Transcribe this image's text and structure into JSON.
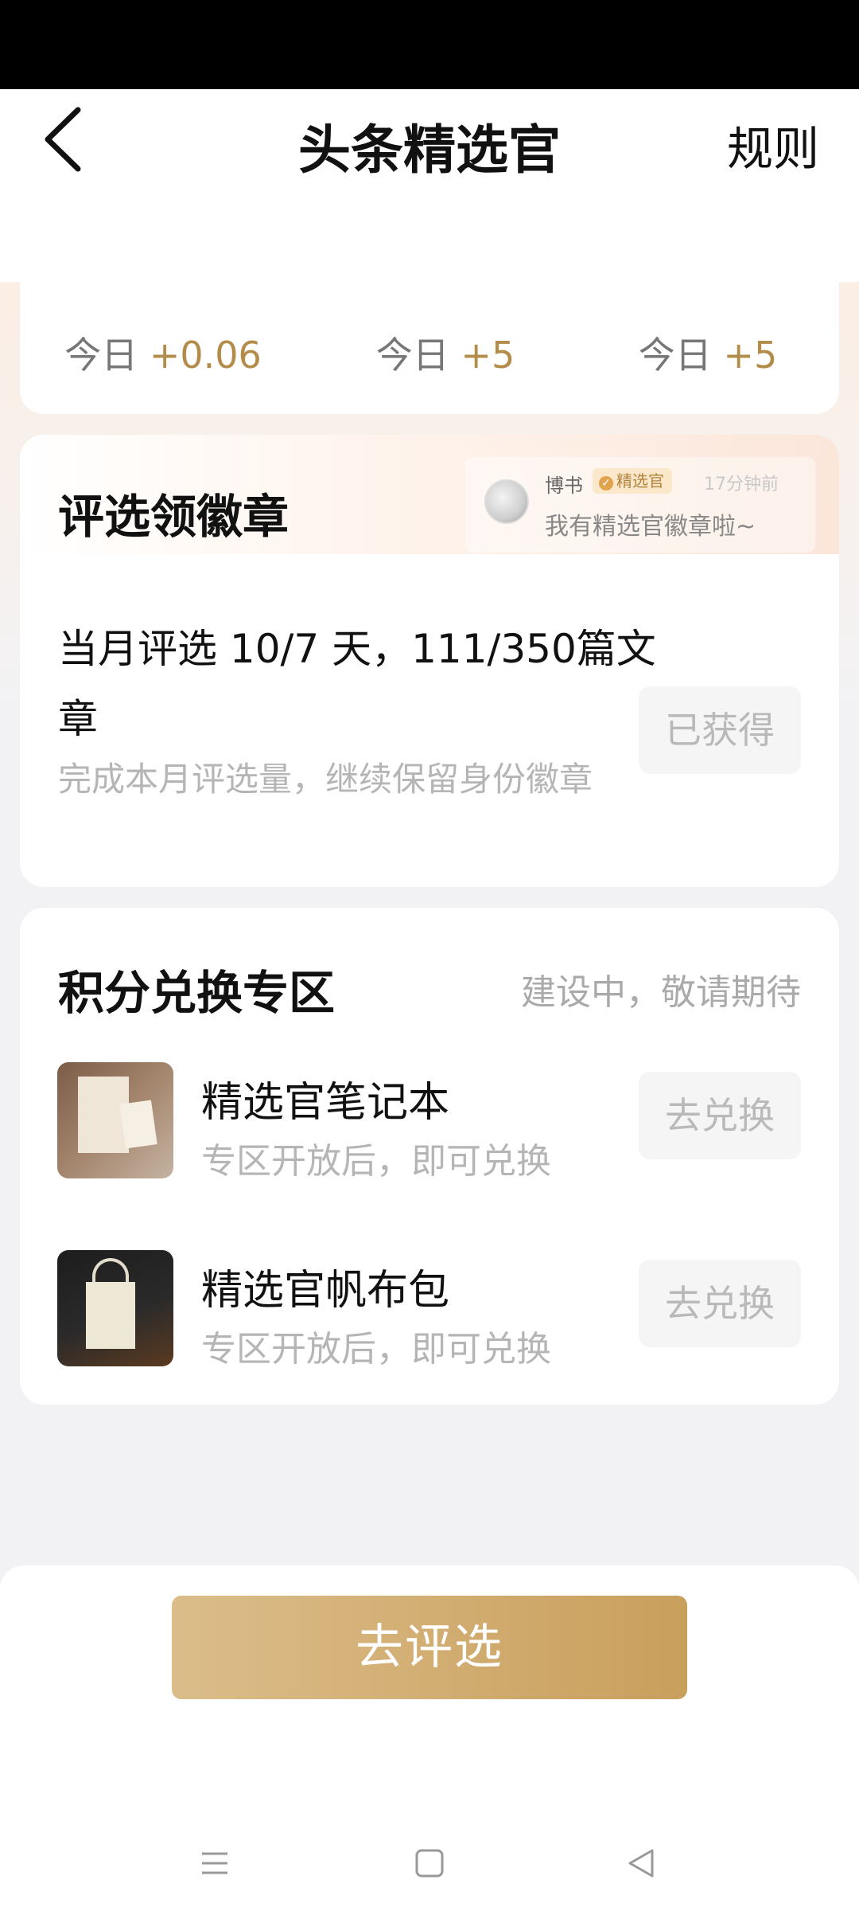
{
  "header": {
    "title": "头条精选官",
    "rules_label": "规则"
  },
  "stats": [
    {
      "today_label": "今日",
      "delta": "+0.06"
    },
    {
      "today_label": "今日",
      "delta": "+5"
    },
    {
      "today_label": "今日",
      "delta": "+5"
    }
  ],
  "badge_section": {
    "title": "评选领徽章",
    "ticker": {
      "user": "博书",
      "tag": "精选官",
      "time": "17分钟前",
      "message": "我有精选官徽章啦~"
    },
    "task_title": "当月评选 10/7 天，111/350篇文章",
    "task_desc": "完成本月评选量，继续保留身份徽章",
    "button_label": "已获得"
  },
  "exchange_section": {
    "title": "积分兑换专区",
    "status": "建设中，敬请期待",
    "items": [
      {
        "name": "精选官笔记本",
        "subtitle": "专区开放后，即可兑换",
        "button": "去兑换",
        "icon": "notebook-image"
      },
      {
        "name": "精选官帆布包",
        "subtitle": "专区开放后，即可兑换",
        "button": "去兑换",
        "icon": "tote-bag-image"
      }
    ]
  },
  "main_button": "去评选",
  "colors": {
    "accent_gold": "#b38c4a",
    "button_gradient_start": "#dbbd8a",
    "button_gradient_end": "#c99f5c"
  }
}
